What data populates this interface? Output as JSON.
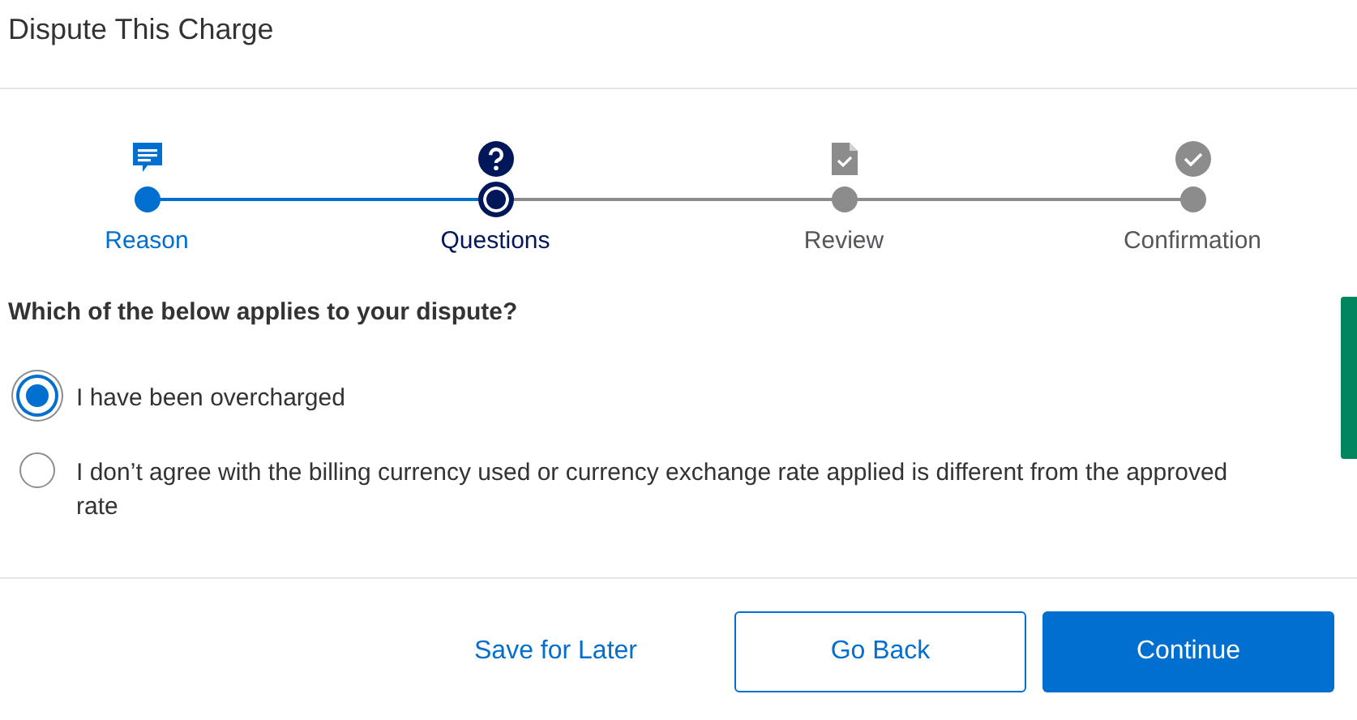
{
  "title": "Dispute This Charge",
  "steps": [
    {
      "label": "Reason",
      "completed": true,
      "current": false
    },
    {
      "label": "Questions",
      "completed": false,
      "current": true
    },
    {
      "label": "Review",
      "completed": false,
      "current": false
    },
    {
      "label": "Confirmation",
      "completed": false,
      "current": false
    }
  ],
  "question": "Which of the below applies to your dispute?",
  "options": [
    {
      "label": "I have been overcharged",
      "selected": true
    },
    {
      "label": "I don’t agree with the billing currency used or currency exchange rate applied is different from the approved rate",
      "selected": false
    }
  ],
  "buttons": [
    {
      "label": "Save for Later",
      "kind": "link"
    },
    {
      "label": "Go Back",
      "kind": "secondary"
    },
    {
      "label": "Continue",
      "kind": "primary"
    }
  ]
}
